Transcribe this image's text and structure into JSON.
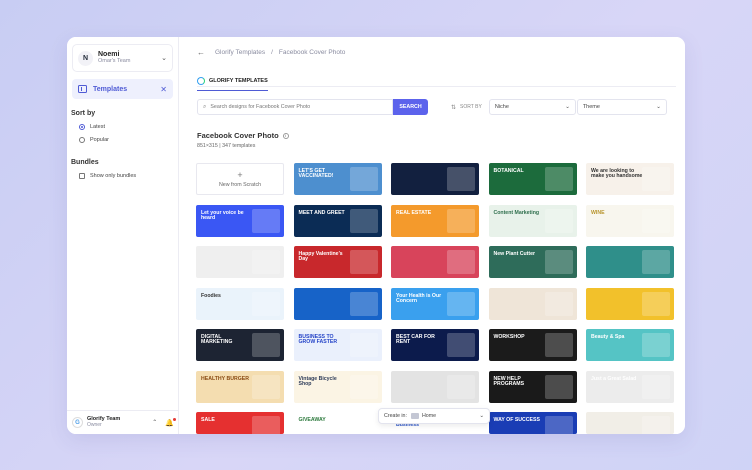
{
  "user": {
    "initial": "N",
    "name": "Noemi",
    "team": "Omar's Team"
  },
  "sidebar": {
    "templates_label": "Templates",
    "sort_title": "Sort by",
    "sort_options": [
      "Latest",
      "Popular"
    ],
    "selected_sort": "Latest",
    "bundles_title": "Bundles",
    "bundles_checkbox": "Show only bundles"
  },
  "footer_user": {
    "name": "Glorify Team",
    "role": "Owner"
  },
  "breadcrumb": {
    "parent": "Glorify Templates",
    "separator": "/",
    "current": "Facebook Cover Photo"
  },
  "tab": {
    "label": "GLORIFY TEMPLATES"
  },
  "search": {
    "placeholder": "Search designs for Facebook Cover Photo",
    "button": "SEARCH"
  },
  "sort": {
    "label": "SORT BY",
    "niche": "Niche",
    "theme": "Theme"
  },
  "section": {
    "title": "Facebook Cover Photo",
    "subtitle": "851×315 | 347 templates"
  },
  "new_card": {
    "label": "New from Scratch"
  },
  "create_in": {
    "label": "Create in:",
    "value": "Home"
  },
  "templates": [
    {
      "bg": "#4d8fcf",
      "text": "LET'S GET VACCINATED!",
      "color": "#ffffff"
    },
    {
      "bg": "#12203f",
      "text": "",
      "color": "#ffffff"
    },
    {
      "bg": "#1c6b3c",
      "text": "BOTANICAL",
      "color": "#ffffff"
    },
    {
      "bg": "#f7f1ea",
      "text": "We are looking to make you handsome",
      "color": "#333333"
    },
    {
      "bg": "#3a57f4",
      "text": "Let your voice be heard",
      "color": "#ffffff"
    },
    {
      "bg": "#0b2c55",
      "text": "MEET AND GREET",
      "color": "#ffffff"
    },
    {
      "bg": "#f49a2c",
      "text": "REAL ESTATE",
      "color": "#ffffff"
    },
    {
      "bg": "#e8f2ea",
      "text": "Content Marketing",
      "color": "#2f6f4d"
    },
    {
      "bg": "#f8f6ee",
      "text": "WINE",
      "color": "#b8952f"
    },
    {
      "bg": "#efefef",
      "text": "",
      "color": "#ffffff"
    },
    {
      "bg": "#c8282c",
      "text": "Happy Valentine's Day",
      "color": "#ffffff"
    },
    {
      "bg": "#d8445b",
      "text": "",
      "color": "#ffffff"
    },
    {
      "bg": "#2e6c5a",
      "text": "New Plant Cutter",
      "color": "#ffffff"
    },
    {
      "bg": "#2f8f8a",
      "text": "",
      "color": "#ffffff"
    },
    {
      "bg": "#eaf3fb",
      "text": "Foodies",
      "color": "#333333"
    },
    {
      "bg": "#1763c8",
      "text": "",
      "color": "#ffffff"
    },
    {
      "bg": "#3aa0ee",
      "text": "Your Health is Our Concern",
      "color": "#ffffff"
    },
    {
      "bg": "#efe5d8",
      "text": "",
      "color": "#333333"
    },
    {
      "bg": "#f2c12b",
      "text": "",
      "color": "#333333"
    },
    {
      "bg": "#1d2433",
      "text": "DIGITAL MARKETING",
      "color": "#ffffff"
    },
    {
      "bg": "#eaf0fc",
      "text": "BUSINESS TO GROW FASTER",
      "color": "#2645c8"
    },
    {
      "bg": "#0c1b4c",
      "text": "BEST CAR FOR RENT",
      "color": "#ffffff"
    },
    {
      "bg": "#1b1b1b",
      "text": "WORKSHOP",
      "color": "#ffffff"
    },
    {
      "bg": "#55c4c5",
      "text": "Beauty & Spa",
      "color": "#ffffff"
    },
    {
      "bg": "#f4ddb0",
      "text": "HEALTHY BURGER",
      "color": "#8a4b14"
    },
    {
      "bg": "#fbf4e4",
      "text": "Vintage Bicycle Shop",
      "color": "#2f3d5a"
    },
    {
      "bg": "#e3e3e3",
      "text": "",
      "color": "#333333"
    },
    {
      "bg": "#1a1a1a",
      "text": "NEW HELP PROGRAMS",
      "color": "#ffffff"
    },
    {
      "bg": "#ececec",
      "text": "Just a Great Salad",
      "color": "#ffffff"
    },
    {
      "bg": "#e53030",
      "text": "SALE",
      "color": "#ffffff"
    },
    {
      "bg": "#ffffff",
      "text": "GIVEAWAY",
      "color": "#2d7a3d"
    },
    {
      "bg": "#ffffff",
      "text": "We Help to Grow Business",
      "color": "#2a53c6"
    },
    {
      "bg": "#1a3db5",
      "text": "WAY OF SUCCESS",
      "color": "#ffffff"
    },
    {
      "bg": "#f1eee7",
      "text": "",
      "color": "#333333"
    },
    {
      "bg": "#3fc7e6",
      "text": "",
      "color": "#ffffff"
    }
  ]
}
